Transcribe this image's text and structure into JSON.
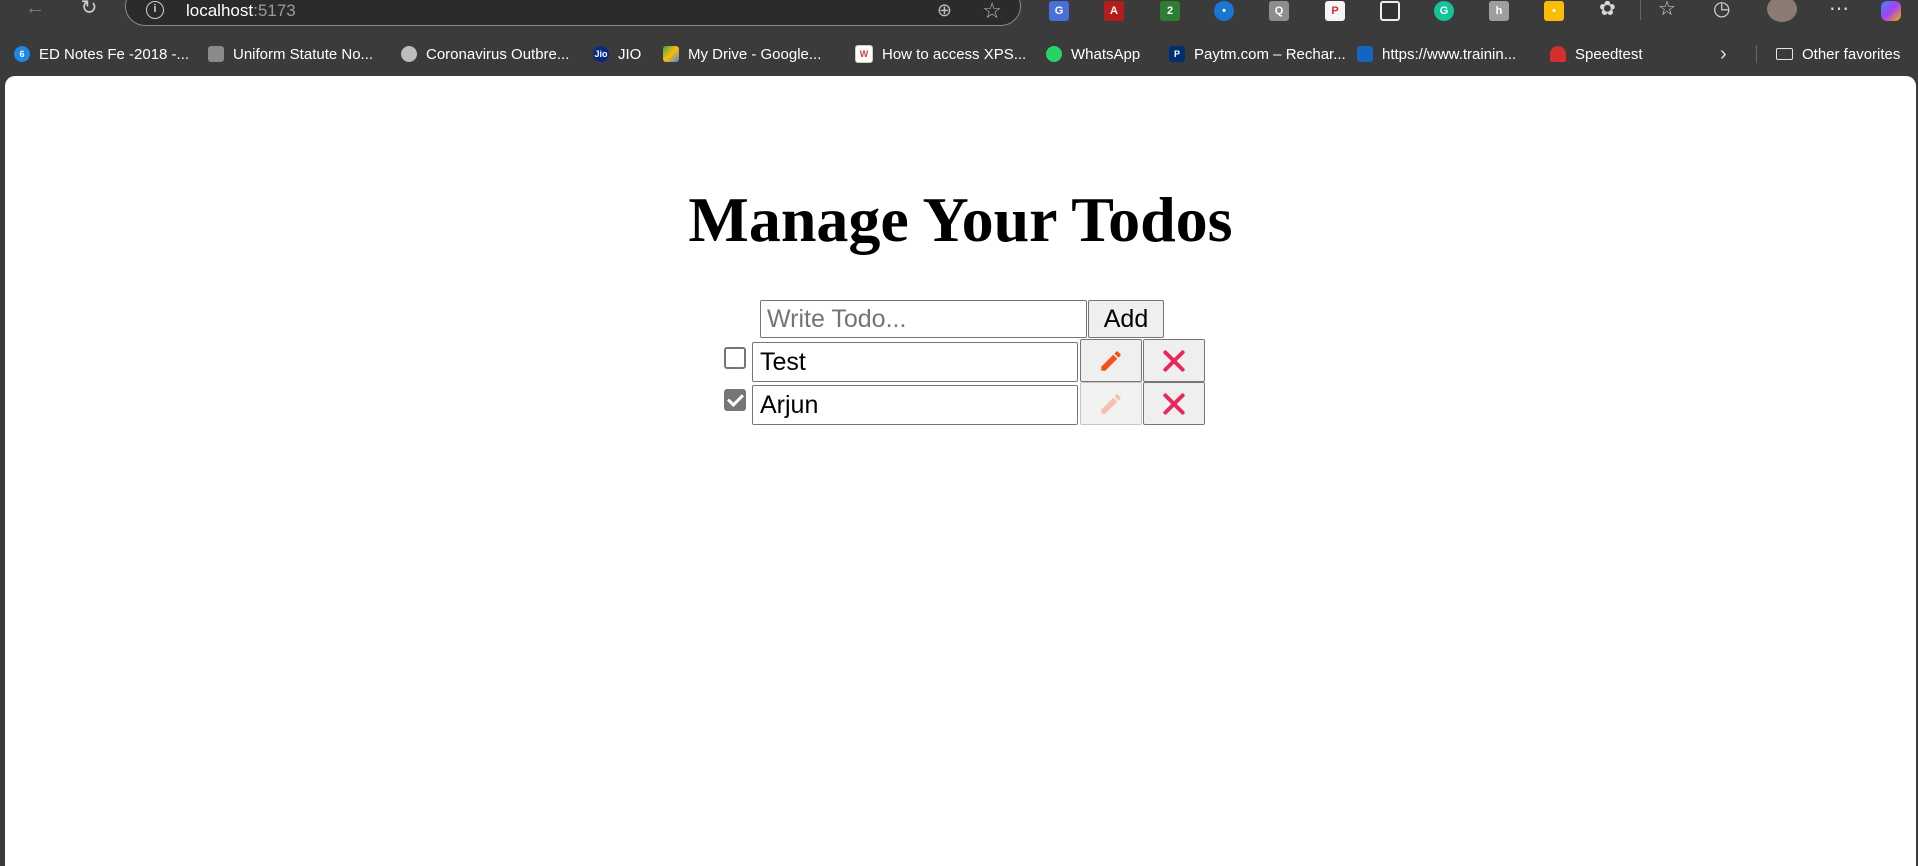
{
  "browser": {
    "address": {
      "host": "localhost",
      "port": ":5173"
    },
    "bookmarks": [
      {
        "label": "ED Notes Fe -2018 -...",
        "color": "#1e88e5"
      },
      {
        "label": "Uniform Statute No...",
        "color": "#8a8a8a"
      },
      {
        "label": "Coronavirus Outbre...",
        "color": "#bdbdbd"
      },
      {
        "label": "JIO",
        "color": "#0a2885"
      },
      {
        "label": "My Drive - Google...",
        "color": "#34a853"
      },
      {
        "label": "How to access XPS...",
        "color": "#e53935"
      },
      {
        "label": "WhatsApp",
        "color": "#25d366"
      },
      {
        "label": "Paytm.com – Rechar...",
        "color": "#002e6e"
      },
      {
        "label": "https://www.trainin...",
        "color": "#1565c0"
      },
      {
        "label": "Speedtest",
        "color": "#d32f2f"
      }
    ],
    "other_favorites": "Other favorites"
  },
  "app": {
    "title": "Manage Your Todos",
    "input": {
      "placeholder": "Write Todo...",
      "value": ""
    },
    "add_label": "Add",
    "todos": [
      {
        "text": "Test",
        "completed": false,
        "edit_enabled": true
      },
      {
        "text": "Arjun",
        "completed": true,
        "edit_enabled": false
      }
    ]
  },
  "colors": {
    "edit_icon": "#f4511e",
    "edit_icon_disabled": "#f6c2b0",
    "delete_icon": "#e8285a"
  }
}
